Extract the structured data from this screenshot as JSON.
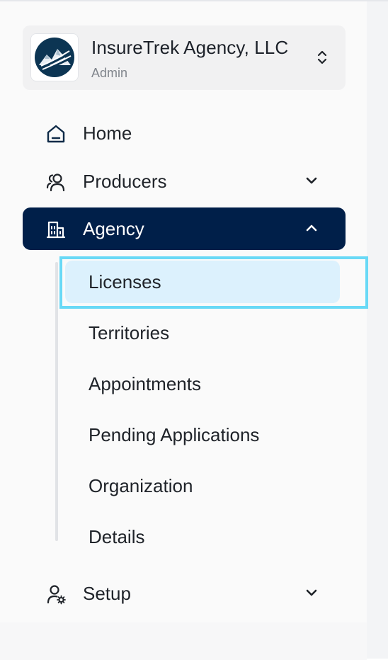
{
  "org": {
    "name": "InsureTrek Agency, LLC",
    "role": "Admin",
    "logo_icon": "mountain-logo-icon",
    "switch_icon": "chevron-up-down-icon"
  },
  "nav": {
    "home": {
      "label": "Home",
      "icon": "home-icon"
    },
    "producers": {
      "label": "Producers",
      "icon": "users-icon",
      "expanded": false
    },
    "agency": {
      "label": "Agency",
      "icon": "building-icon",
      "expanded": true,
      "active": true,
      "subitems": [
        {
          "label": "Licenses",
          "selected": true
        },
        {
          "label": "Territories",
          "selected": false
        },
        {
          "label": "Appointments",
          "selected": false
        },
        {
          "label": "Pending Applications",
          "selected": false
        },
        {
          "label": "Organization",
          "selected": false
        },
        {
          "label": "Details",
          "selected": false
        }
      ]
    },
    "setup": {
      "label": "Setup",
      "icon": "user-settings-icon",
      "expanded": false
    }
  },
  "colors": {
    "active_bg": "#001f49",
    "selected_bg": "#dcf1fd",
    "highlight_border": "#69d9f6",
    "sidebar_bg": "#fafafa",
    "text": "#1f2329",
    "muted_text": "#80858c"
  }
}
